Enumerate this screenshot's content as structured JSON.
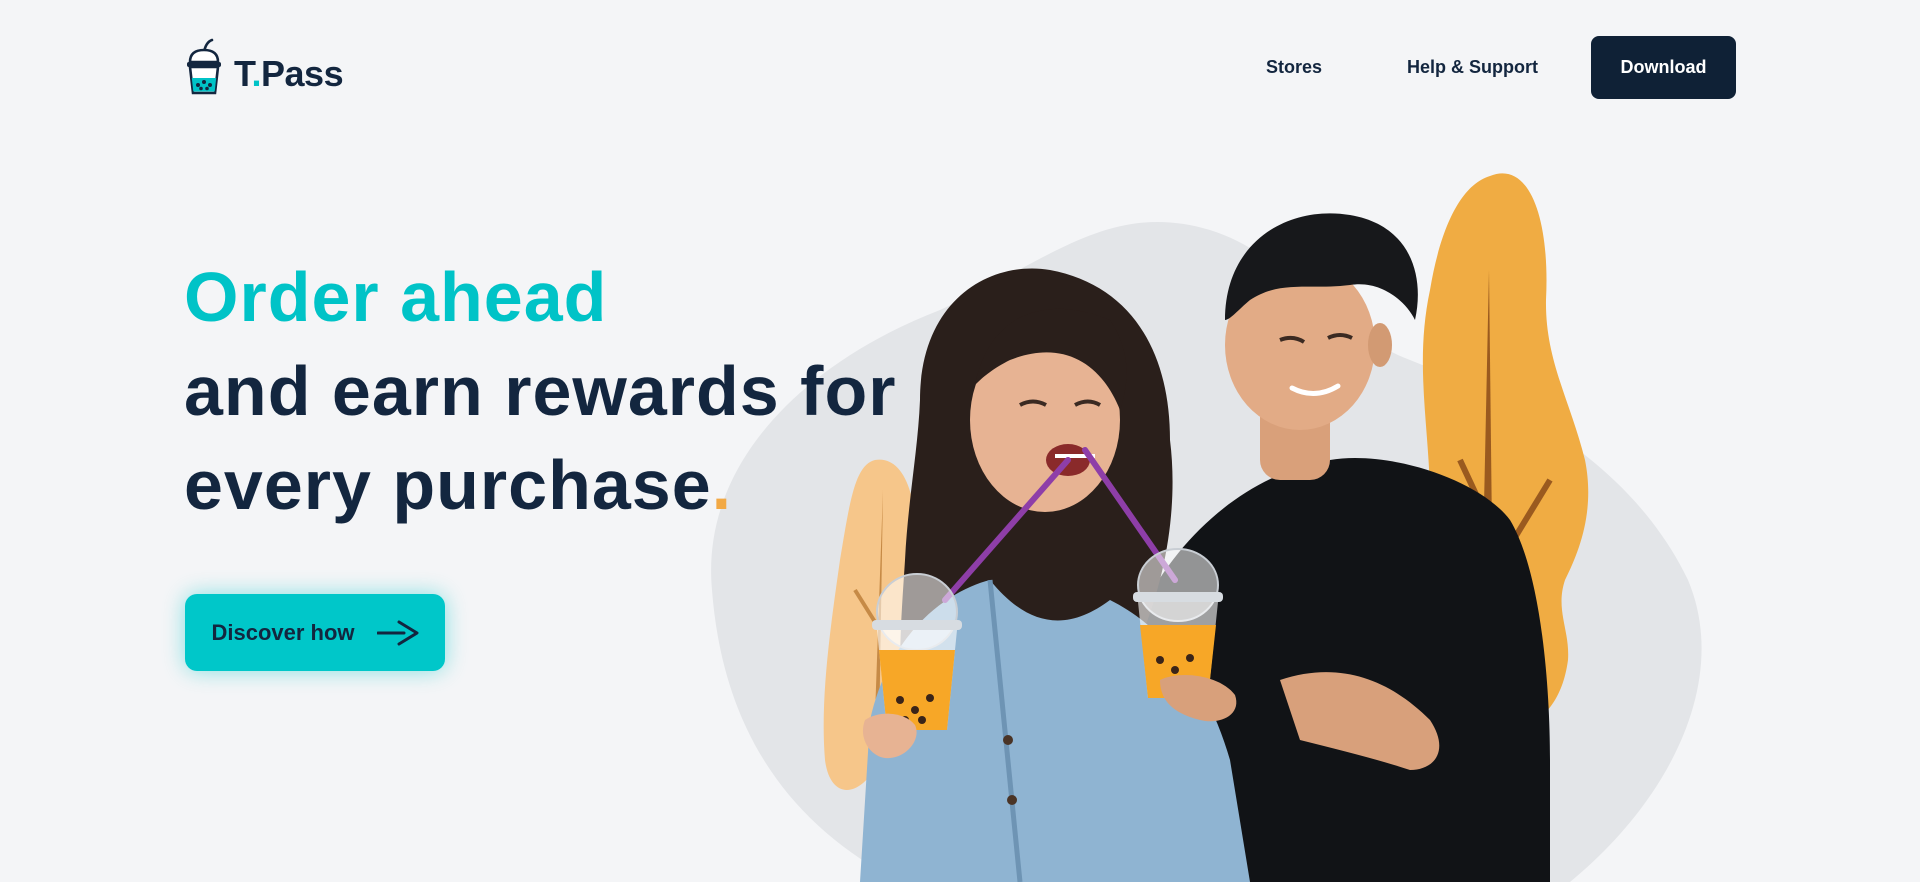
{
  "header": {
    "logo": {
      "name_main": "T",
      "name_dot": ".",
      "name_rest": "Pass",
      "icon": "bubble-tea-cup-icon"
    },
    "nav": {
      "items": [
        {
          "label": "Stores"
        },
        {
          "label": "Help & Support"
        }
      ],
      "download_label": "Download"
    }
  },
  "hero": {
    "headline_accent": "Order ahead",
    "headline_line2": "and earn rewards for",
    "headline_line3": "every purchase",
    "headline_period": ".",
    "cta_label": "Discover how",
    "cta_icon": "arrow-right-icon"
  },
  "colors": {
    "background": "#f4f5f7",
    "accent_teal": "#00c3c7",
    "navy": "#13263f",
    "orange": "#f2a945",
    "blob_gray": "#e3e5e8"
  }
}
